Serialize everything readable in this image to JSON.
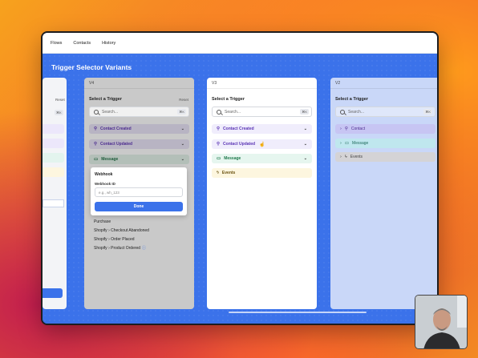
{
  "nav": {
    "items": [
      "Flows",
      "Contacts",
      "History"
    ]
  },
  "page": {
    "title": "Trigger Selector Variants"
  },
  "panels": {
    "left": {
      "reset": "Reset",
      "kbd": "⌘K"
    },
    "v4": {
      "version": "V4",
      "select": "Select a Trigger",
      "reset": "Reset",
      "search_placeholder": "Search...",
      "kbd": "⌘K",
      "rows": [
        {
          "icon": "person-icon",
          "label": "Contact Created"
        },
        {
          "icon": "person-icon",
          "label": "Contact Updated"
        },
        {
          "icon": "message-icon",
          "label": "Message"
        }
      ],
      "popup": {
        "title": "Webhook",
        "field_label": "Webhook ID",
        "placeholder": "e.g., wh_123",
        "button": "Done"
      },
      "list": [
        "Purchase",
        "Shopify › Checkout Abandoned",
        "Shopify › Order Placed",
        "Shopify › Product Ordered"
      ]
    },
    "v3": {
      "version": "V3",
      "select": "Select a Trigger",
      "search_placeholder": "Search...",
      "kbd": "⌘K",
      "rows": [
        {
          "label": "Contact Created"
        },
        {
          "label": "Contact Updated"
        },
        {
          "label": "Message"
        },
        {
          "label": "Events"
        }
      ]
    },
    "v2": {
      "version": "V2",
      "select": "Select a Trigger",
      "search_placeholder": "Search...",
      "kbd": "⌘K",
      "rows": [
        {
          "label": "Contact"
        },
        {
          "label": "Message"
        },
        {
          "label": "Events"
        }
      ]
    }
  }
}
